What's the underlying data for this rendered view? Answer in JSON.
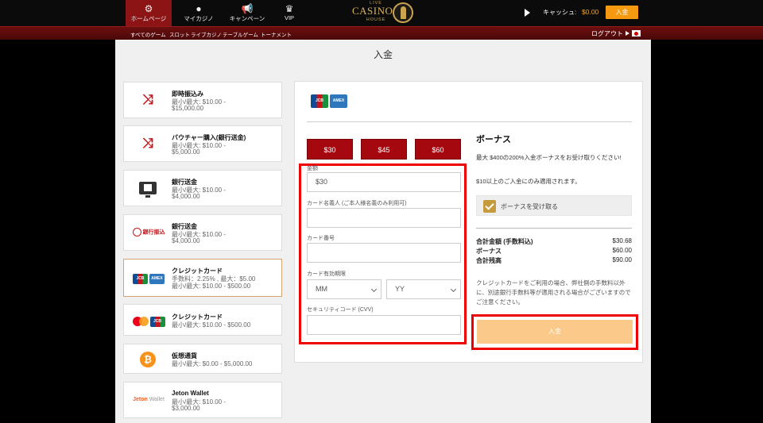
{
  "header": {
    "nav": [
      {
        "label": "ホームページ",
        "icon": "home-gear-icon"
      },
      {
        "label": "マイカジノ",
        "icon": "user-icon"
      },
      {
        "label": "キャンペーン",
        "icon": "megaphone-icon"
      },
      {
        "label": "VIP",
        "icon": "crown-icon"
      }
    ],
    "logo": {
      "top": "LIVE",
      "main": "CASINO",
      "bottom": "HOUSE"
    },
    "cash_label": "キャッシュ:",
    "cash_value": "$0.00",
    "deposit_button": "入金"
  },
  "subnav": {
    "links": [
      "すべてのゲーム",
      "スロット",
      "ライブカジノ",
      "テーブルゲーム",
      "トーナメント"
    ],
    "logout": "ログアウト"
  },
  "page_title": "入金",
  "methods": [
    {
      "title": "即時振込み",
      "lines": [
        "最小/最大: $10.00 -",
        "$15,000.00"
      ],
      "icon": "shuffle-icon"
    },
    {
      "title": "バウチャー購入(銀行送金)",
      "lines": [
        "最小/最大: $10.00 -",
        "$5,000.00"
      ],
      "icon": "shuffle-icon"
    },
    {
      "title": "銀行送金",
      "lines": [
        "最小/最大: $10.00 -",
        "$4,000.00"
      ],
      "icon": "bank-monitor-icon"
    },
    {
      "title": "銀行送金",
      "lines": [
        "最小/最大: $10.00 -",
        "$4,000.00"
      ],
      "icon": "bank-transfer-logo-icon",
      "logo_text": "銀行振込"
    },
    {
      "title": "クレジットカード",
      "lines": [
        "手数料：2.25% , 最大：$5.00",
        "最小/最大: $10.00 - $500.00"
      ],
      "icon": "jcb-amex-icon",
      "selected": true
    },
    {
      "title": "クレジットカード",
      "lines": [
        "最小/最大: $10.00 - $500.00"
      ],
      "icon": "mastercard-jcb-icon"
    },
    {
      "title": "仮想通貨",
      "lines": [
        "最小/最大: $0.00 - $5,000.00"
      ],
      "icon": "bitcoin-icon"
    },
    {
      "title": "Jeton Wallet",
      "lines": [
        "最小/最大: $10.00 -",
        "$3,000.00"
      ],
      "icon": "jeton-wallet-icon",
      "logo_text": "Jeton",
      "logo_text2": "Wallet"
    }
  ],
  "deposit_form": {
    "amount_buttons": [
      "$30",
      "$45",
      "$60"
    ],
    "amount_label": "金額",
    "amount_value": "$30",
    "holder_label": "カード名義人 (ご本人様名義のみ利用可)",
    "holder_value": "",
    "number_label": "カード番号",
    "number_value": "",
    "expiry_label": "カード有効期限",
    "expiry_month": "MM",
    "expiry_year": "YY",
    "cvv_label": "セキュリティコード (CVV)",
    "cvv_value": ""
  },
  "bonus": {
    "title": "ボーナス",
    "text": "最大 $400の200%入金ボーナスをお受け取りください!",
    "note": "$10以上のご入金にのみ適用されます。",
    "checkbox_label": "ボーナスを受け取る",
    "checked": true
  },
  "summary": [
    {
      "label": "合計金額 (手数料込)",
      "value": "$30.68"
    },
    {
      "label": "ボーナス",
      "value": "$60.00"
    },
    {
      "label": "合計残高",
      "value": "$90.00"
    }
  ],
  "card_note": "クレジットカードをご利用の場合、弊社側の手数料以外に、別途銀行手数料等が適用される場合がございますのでご注意ください。",
  "submit_button": "入金",
  "colors": {
    "brand_red": "#a5080f",
    "accent_orange": "#f59a10",
    "highlight_red": "#e00000",
    "gold": "#c59b3b"
  }
}
